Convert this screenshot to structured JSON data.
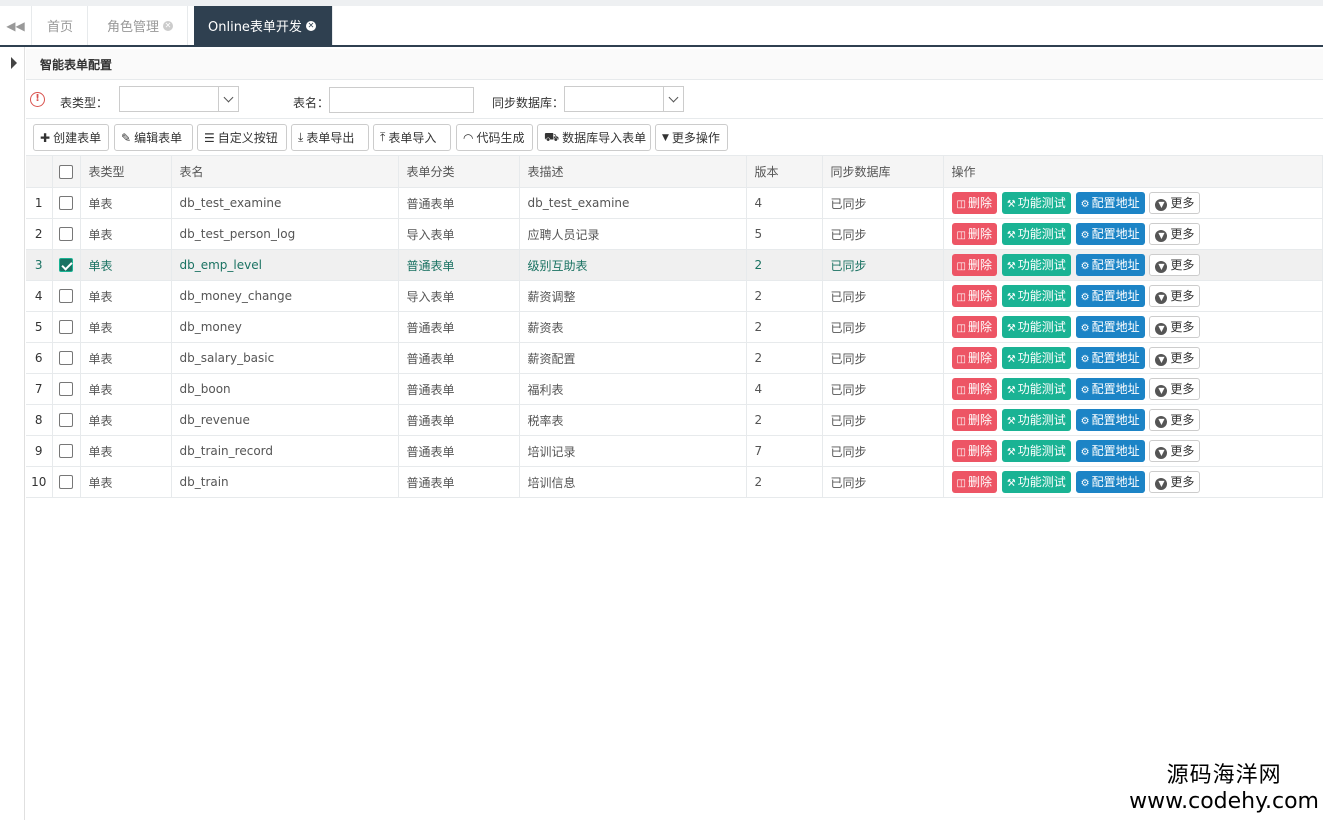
{
  "tabs": [
    {
      "label": "首页",
      "closable": false,
      "active": false
    },
    {
      "label": "角色管理",
      "closable": true,
      "active": false
    },
    {
      "label": "Online表单开发",
      "closable": true,
      "active": true
    }
  ],
  "panel": {
    "title": "智能表单配置"
  },
  "filters": {
    "table_type_label": "表类型：",
    "table_name_label": "表名：",
    "sync_db_label": "同步数据库："
  },
  "toolbar": {
    "create": "创建表单",
    "edit": "编辑表单",
    "custom_button": "自定义按钮",
    "export": "表单导出",
    "import": "表单导入",
    "codegen": "代码生成",
    "db_import": "数据库导入表单",
    "more": "更多操作"
  },
  "table": {
    "headers": {
      "type": "表类型",
      "name": "表名",
      "category": "表单分类",
      "desc": "表描述",
      "version": "版本",
      "sync": "同步数据库",
      "ops": "操作"
    },
    "ops_labels": {
      "delete": "删除",
      "test": "功能测试",
      "config": "配置地址",
      "more": "更多"
    },
    "rows": [
      {
        "no": "1",
        "checked": false,
        "type": "单表",
        "name": "db_test_examine",
        "category": "普通表单",
        "desc": "db_test_examine",
        "version": "4",
        "sync": "已同步"
      },
      {
        "no": "2",
        "checked": false,
        "type": "单表",
        "name": "db_test_person_log",
        "category": "导入表单",
        "desc": "应聘人员记录",
        "version": "5",
        "sync": "已同步"
      },
      {
        "no": "3",
        "checked": true,
        "type": "单表",
        "name": "db_emp_level",
        "category": "普通表单",
        "desc": "级别互助表",
        "version": "2",
        "sync": "已同步"
      },
      {
        "no": "4",
        "checked": false,
        "type": "单表",
        "name": "db_money_change",
        "category": "导入表单",
        "desc": "薪资调整",
        "version": "2",
        "sync": "已同步"
      },
      {
        "no": "5",
        "checked": false,
        "type": "单表",
        "name": "db_money",
        "category": "普通表单",
        "desc": "薪资表",
        "version": "2",
        "sync": "已同步"
      },
      {
        "no": "6",
        "checked": false,
        "type": "单表",
        "name": "db_salary_basic",
        "category": "普通表单",
        "desc": "薪资配置",
        "version": "2",
        "sync": "已同步"
      },
      {
        "no": "7",
        "checked": false,
        "type": "单表",
        "name": "db_boon",
        "category": "普通表单",
        "desc": "福利表",
        "version": "4",
        "sync": "已同步"
      },
      {
        "no": "8",
        "checked": false,
        "type": "单表",
        "name": "db_revenue",
        "category": "普通表单",
        "desc": "税率表",
        "version": "2",
        "sync": "已同步"
      },
      {
        "no": "9",
        "checked": false,
        "type": "单表",
        "name": "db_train_record",
        "category": "普通表单",
        "desc": "培训记录",
        "version": "7",
        "sync": "已同步"
      },
      {
        "no": "10",
        "checked": false,
        "type": "单表",
        "name": "db_train",
        "category": "普通表单",
        "desc": "培训信息",
        "version": "2",
        "sync": "已同步"
      }
    ]
  },
  "watermark": {
    "line1": "源码海洋网",
    "line2": "www.codehy.com"
  },
  "colors": {
    "accent": "#2f4050",
    "delete": "#ed5565",
    "test": "#1ab394",
    "config": "#1c84c6",
    "selected_text": "#1a7262"
  }
}
